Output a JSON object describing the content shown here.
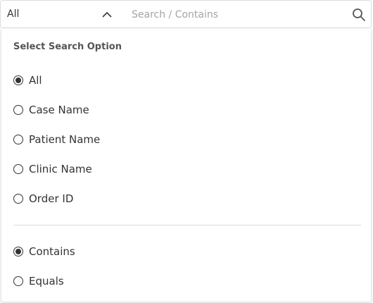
{
  "search": {
    "scope_value": "All",
    "placeholder": "Search / Contains",
    "value": ""
  },
  "panel": {
    "title": "Select Search Option",
    "field_options": [
      {
        "label": "All",
        "checked": true
      },
      {
        "label": "Case Name",
        "checked": false
      },
      {
        "label": "Patient Name",
        "checked": false
      },
      {
        "label": "Clinic Name",
        "checked": false
      },
      {
        "label": "Order ID",
        "checked": false
      }
    ],
    "match_options": [
      {
        "label": "Contains",
        "checked": true
      },
      {
        "label": "Equals",
        "checked": false
      }
    ]
  },
  "icons": {
    "scope_toggle": "chevron-up-icon",
    "search": "search-icon"
  },
  "colors": {
    "text": "#333333",
    "placeholder": "#a4a4a4",
    "border": "#dcdcdc",
    "divider": "#dddddd"
  }
}
